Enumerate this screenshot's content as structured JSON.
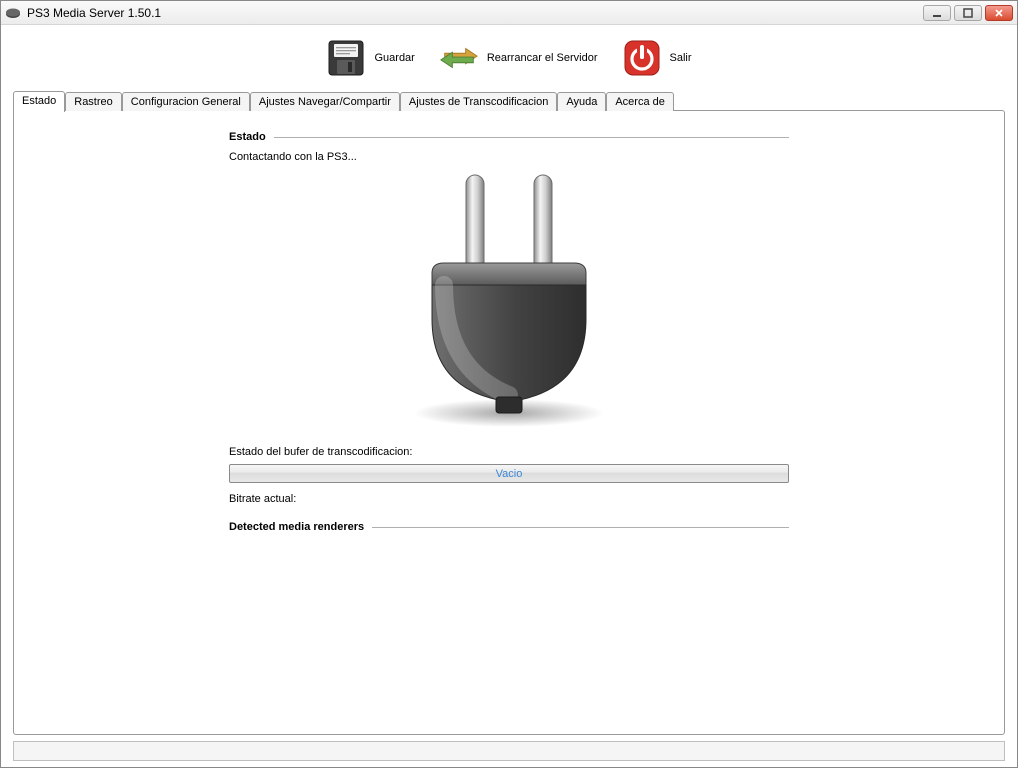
{
  "window": {
    "title": "PS3 Media Server 1.50.1"
  },
  "toolbar": {
    "save_label": "Guardar",
    "restart_label": "Rearrancar el Servidor",
    "quit_label": "Salir"
  },
  "tabs": {
    "status": "Estado",
    "trace": "Rastreo",
    "general": "Configuracion General",
    "navshare": "Ajustes Navegar/Compartir",
    "transcode": "Ajustes de Transcodificacion",
    "help": "Ayuda",
    "about": "Acerca de"
  },
  "status_panel": {
    "group_title": "Estado",
    "connecting_text": "Contactando con la PS3...",
    "buffer_label": "Estado del bufer de transcodificacion:",
    "buffer_value": "Vacio",
    "bitrate_label": "Bitrate actual:",
    "detected_label": "Detected media renderers"
  }
}
